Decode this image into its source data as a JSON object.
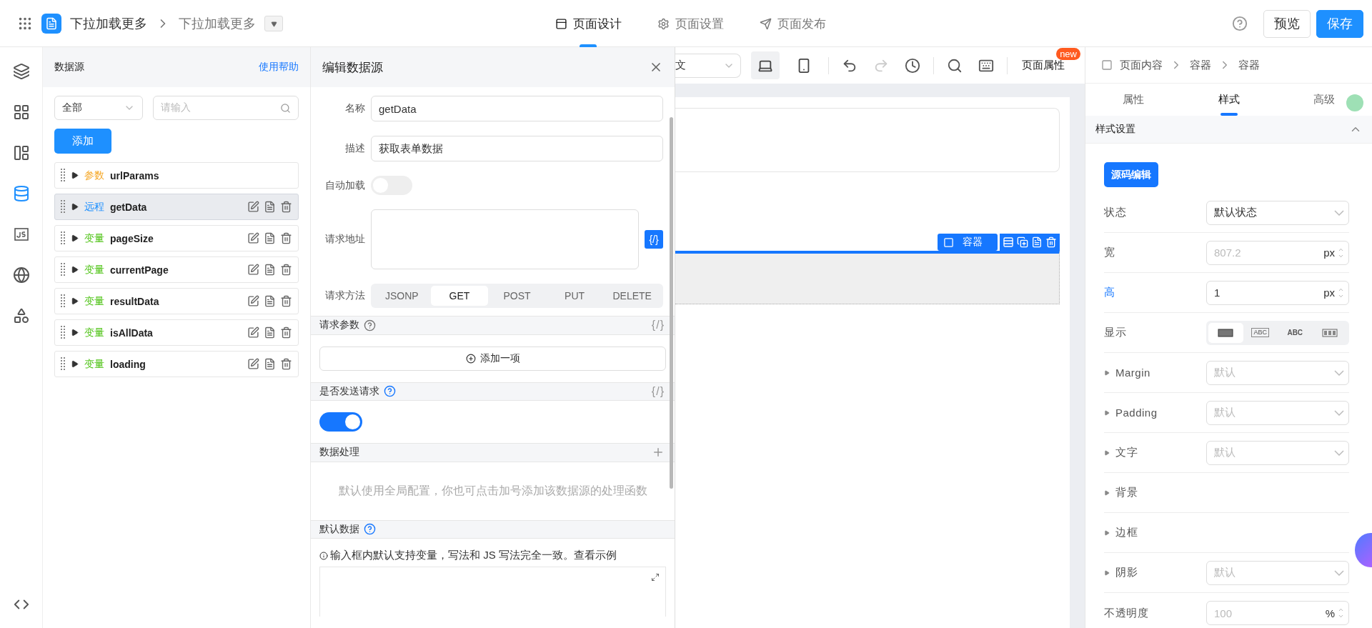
{
  "topbar": {
    "app_title": "下拉加载更多",
    "page_name": "下拉加载更多",
    "tabs": [
      {
        "kind": "design",
        "label": "页面设计",
        "selected": true
      },
      {
        "kind": "settings",
        "label": "页面设置",
        "selected": false
      },
      {
        "kind": "publish",
        "label": "页面发布",
        "selected": false
      }
    ],
    "preview": "预览",
    "save": "保存"
  },
  "rail": [
    {
      "kind": "outline",
      "selected": false
    },
    {
      "kind": "components",
      "selected": false
    },
    {
      "kind": "layout",
      "selected": false
    },
    {
      "kind": "datasource",
      "selected": true
    },
    {
      "kind": "js",
      "selected": false
    },
    {
      "kind": "globe",
      "selected": false
    },
    {
      "kind": "apps",
      "selected": false
    },
    {
      "kind": "code",
      "selected": false
    }
  ],
  "datasource": {
    "title": "数据源",
    "help": "使用帮助",
    "filter": "全部",
    "search_placeholder": "请输入",
    "add": "添加",
    "items": [
      {
        "tag": "参数",
        "color": "#f5a623",
        "name": "urlParams",
        "selected": false,
        "has_actions": false
      },
      {
        "tag": "远程",
        "color": "#1e90ff",
        "name": "getData",
        "selected": true,
        "has_actions": true
      },
      {
        "tag": "变量",
        "color": "#52c41a",
        "name": "pageSize",
        "selected": false,
        "has_actions": true
      },
      {
        "tag": "变量",
        "color": "#52c41a",
        "name": "currentPage",
        "selected": false,
        "has_actions": true
      },
      {
        "tag": "变量",
        "color": "#52c41a",
        "name": "resultData",
        "selected": false,
        "has_actions": true
      },
      {
        "tag": "变量",
        "color": "#52c41a",
        "name": "isAllData",
        "selected": false,
        "has_actions": true
      },
      {
        "tag": "变量",
        "color": "#52c41a",
        "name": "loading",
        "selected": false,
        "has_actions": true
      }
    ]
  },
  "editor": {
    "title": "编辑数据源",
    "fields": [
      {
        "label": "名称",
        "value": "getData"
      },
      {
        "label": "描述",
        "value": "获取表单数据"
      }
    ],
    "auto_load": {
      "label": "自动加载",
      "on": false
    },
    "url": {
      "label": "请求地址",
      "code_button": "{/}"
    },
    "method": {
      "label": "请求方法",
      "options": [
        {
          "label": "JSONP",
          "selected": false
        },
        {
          "label": "GET",
          "selected": true
        },
        {
          "label": "POST",
          "selected": false
        },
        {
          "label": "PUT",
          "selected": false
        },
        {
          "label": "DELETE",
          "selected": false
        }
      ]
    },
    "sections": [
      {
        "kind": "params",
        "title": "请求参数",
        "help_highlighted": false,
        "trailing": "{/}",
        "button": "添加一项"
      },
      {
        "kind": "switch",
        "title": "是否发送请求",
        "help_highlighted": true,
        "trailing": "{/}",
        "on": true
      },
      {
        "kind": "hint",
        "title": "数据处理",
        "addable": true,
        "text": "默认使用全局配置，你也可点击加号添加该数据源的处理函数"
      },
      {
        "kind": "code",
        "title": "默认数据",
        "help_highlighted": true,
        "note": "输入框内默认支持变量，写法和 JS 写法完全一致。查看示例"
      }
    ]
  },
  "canvas": {
    "language": "文",
    "devices": [
      {
        "kind": "desktop",
        "selected": true
      },
      {
        "kind": "mobile",
        "selected": false
      }
    ],
    "actions": [
      {
        "kind": "undo",
        "disabled": false
      },
      {
        "kind": "redo",
        "disabled": true
      },
      {
        "kind": "history",
        "disabled": false
      },
      {
        "kind": "search",
        "disabled": false
      },
      {
        "kind": "keyboard",
        "disabled": false
      }
    ],
    "page_props": "页面属性",
    "badge": "new",
    "container_label": "容器"
  },
  "inspector": {
    "breadcrumb": [
      "页面内容",
      "容器",
      "容器"
    ],
    "tabs": [
      {
        "label": "属性",
        "selected": false
      },
      {
        "label": "样式",
        "selected": true
      },
      {
        "label": "高级",
        "selected": false
      }
    ],
    "section": {
      "title": "样式设置",
      "expanded": true
    },
    "source_button": "源码编辑",
    "rows": [
      {
        "kind": "select",
        "label": "状态",
        "value": "默认状态",
        "expandable": false,
        "modified": false
      },
      {
        "kind": "number",
        "label": "宽",
        "placeholder": "807.2",
        "unit": "px",
        "expandable": false,
        "modified": false
      },
      {
        "kind": "number",
        "label": "高",
        "value": "1",
        "unit": "px",
        "expandable": false,
        "modified": true
      },
      {
        "kind": "display",
        "label": "显示",
        "expandable": false,
        "modified": false,
        "options": [
          {
            "kind": "block",
            "selected": true
          },
          {
            "kind": "inline-block",
            "label": "ABC",
            "selected": false
          },
          {
            "kind": "inline",
            "label": "ABC",
            "selected": false
          },
          {
            "kind": "flex",
            "selected": false
          }
        ]
      },
      {
        "kind": "select",
        "label": "Margin",
        "placeholder": "默认",
        "expandable": true,
        "modified": false
      },
      {
        "kind": "select",
        "label": "Padding",
        "placeholder": "默认",
        "expandable": true,
        "modified": false
      },
      {
        "kind": "select",
        "label": "文字",
        "placeholder": "默认",
        "expandable": true,
        "modified": false
      },
      {
        "kind": "group",
        "label": "背景",
        "expandable": true,
        "modified": false
      },
      {
        "kind": "group",
        "label": "边框",
        "expandable": true,
        "modified": false
      },
      {
        "kind": "select",
        "label": "阴影",
        "placeholder": "默认",
        "expandable": true,
        "modified": false
      },
      {
        "kind": "number",
        "label": "不透明度",
        "placeholder": "100",
        "unit": "%",
        "expandable": false,
        "modified": false
      }
    ]
  }
}
